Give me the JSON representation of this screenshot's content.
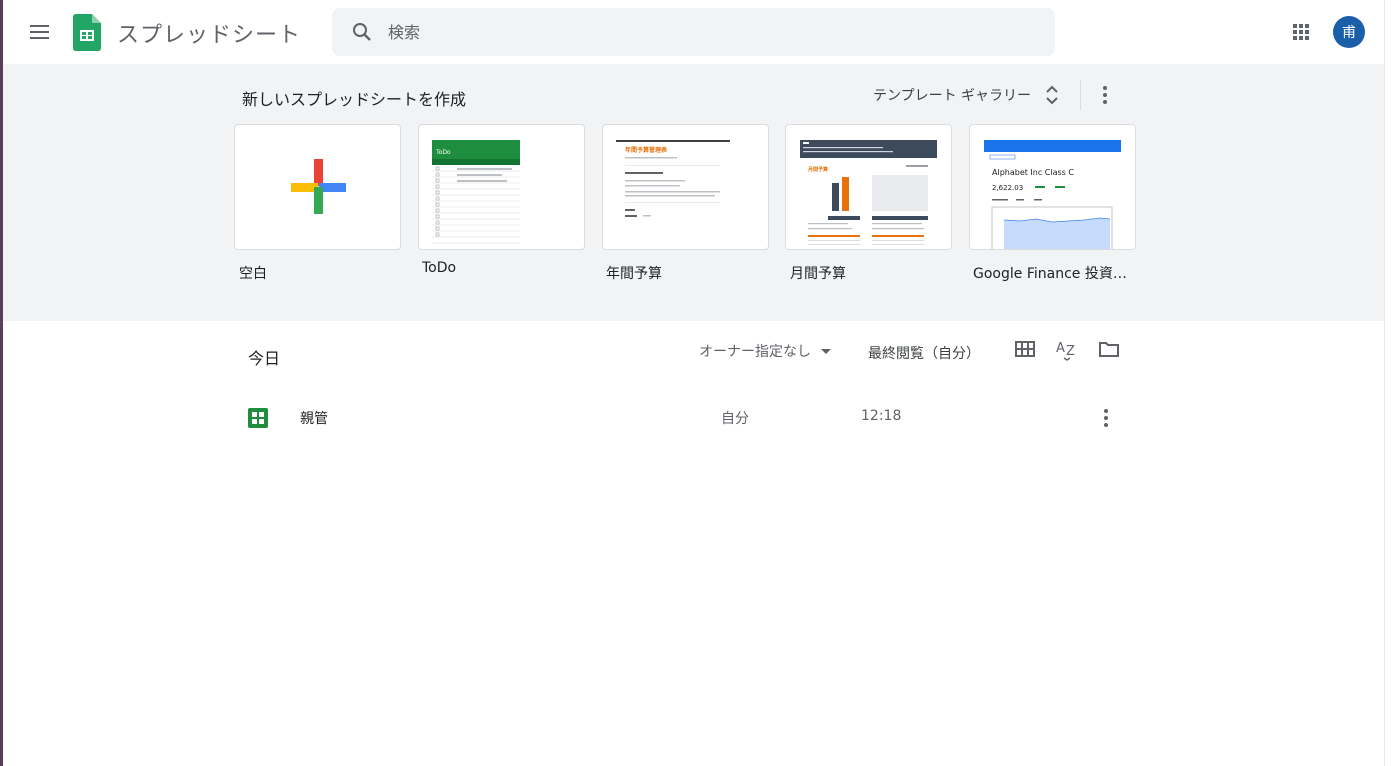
{
  "app": {
    "title": "スプレッドシート"
  },
  "search": {
    "placeholder": "検索"
  },
  "user": {
    "avatar_initial": "甫"
  },
  "templates": {
    "heading": "新しいスプレッドシートを作成",
    "gallery_label": "テンプレート ギャラリー",
    "items": [
      {
        "label": "空白"
      },
      {
        "label": "ToDo"
      },
      {
        "label": "年間予算"
      },
      {
        "label": "月間予算"
      },
      {
        "label": "Google Finance 投資…"
      }
    ],
    "thumb_text": {
      "todo_title": "ToDo",
      "annual_title": "年間予算管理表",
      "monthly_title": "月間予算",
      "finance_title": "Alphabet Inc Class C",
      "finance_price": "2,622.03"
    }
  },
  "list": {
    "section_title": "今日",
    "owner_filter": "オーナー指定なし",
    "sort_label": "最終閲覧（自分）",
    "files": [
      {
        "name": "親管",
        "owner": "自分",
        "time": "12:18"
      }
    ]
  },
  "colors": {
    "sheets_green": "#1e8e3e",
    "accent_blue": "#1a73e8",
    "avatar_bg": "#1a5fa8"
  }
}
